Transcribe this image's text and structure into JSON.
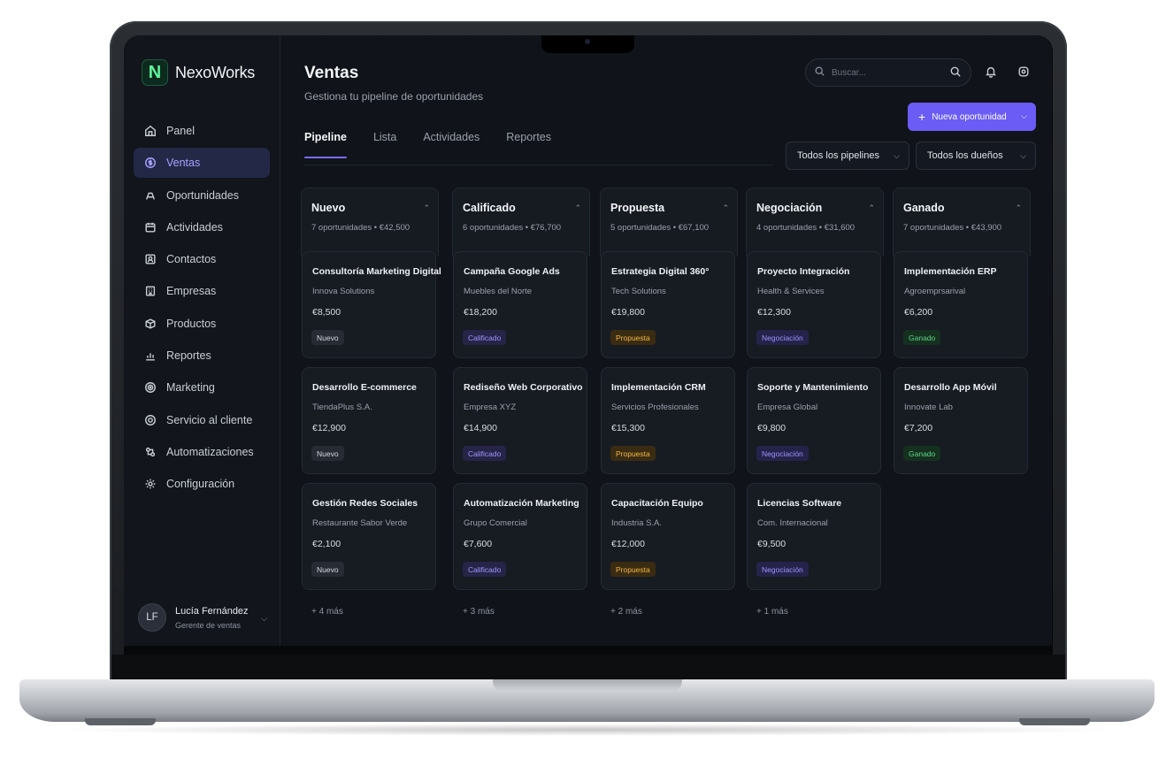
{
  "app": {
    "logo_letter": "N",
    "name": "NexoWorks",
    "brand_color": "#5ff29a",
    "accent_color": "#6a5cf5"
  },
  "sidebar": {
    "items": [
      {
        "label": "Panel",
        "icon": "home-icon",
        "active": false
      },
      {
        "label": "Ventas",
        "icon": "dollar-circle-icon",
        "active": true
      },
      {
        "label": "Oportunidades",
        "icon": "opportunity-icon",
        "active": false
      },
      {
        "label": "Actividades",
        "icon": "calendar-icon",
        "active": false
      },
      {
        "label": "Contactos",
        "icon": "contacts-icon",
        "active": false
      },
      {
        "label": "Empresas",
        "icon": "building-icon",
        "active": false
      },
      {
        "label": "Productos",
        "icon": "box-icon",
        "active": false
      },
      {
        "label": "Reportes",
        "icon": "chart-icon",
        "active": false
      },
      {
        "label": "Marketing",
        "icon": "target-icon",
        "active": false
      },
      {
        "label": "Servicio al cliente",
        "icon": "support-icon",
        "active": false
      },
      {
        "label": "Automatizaciones",
        "icon": "automation-icon",
        "active": false
      },
      {
        "label": "Configuración",
        "icon": "gear-icon",
        "active": false
      }
    ]
  },
  "user": {
    "initials": "LF",
    "name": "Lucía Fernández",
    "role": "Gerente de ventas"
  },
  "header": {
    "title": "Ventas",
    "subtitle": "Gestiona tu pipeline de oportunidades",
    "search_placeholder": "Buscar...",
    "new_button": "Nueva oportunidad"
  },
  "tabs": [
    {
      "label": "Pipeline",
      "active": true
    },
    {
      "label": "Lista",
      "active": false
    },
    {
      "label": "Actividades",
      "active": false
    },
    {
      "label": "Reportes",
      "active": false
    }
  ],
  "filters": {
    "pipelines": "Todos los pipelines",
    "owners": "Todos los dueños"
  },
  "columns": [
    {
      "title": "Nuevo",
      "meta": "7 oportunidades • €42,500",
      "more": "+ 4 más",
      "cards": [
        {
          "title": "Consultoría Marketing Digital",
          "company": "Innova Solutions",
          "value": "€8,500",
          "badge": "Nuevo",
          "badge_class": "b-nuevo"
        },
        {
          "title": "Desarrollo E-commerce",
          "company": "TiendaPlus S.A.",
          "value": "€12,900",
          "badge": "Nuevo",
          "badge_class": "b-nuevo"
        },
        {
          "title": "Gestión Redes Sociales",
          "company": "Restaurante Sabor Verde",
          "value": "€2,100",
          "badge": "Nuevo",
          "badge_class": "b-nuevo"
        }
      ]
    },
    {
      "title": "Calificado",
      "meta": "6 oportunidades • €76,700",
      "more": "+ 3 más",
      "cards": [
        {
          "title": "Campaña Google Ads",
          "company": "Muebles del Norte",
          "value": "€18,200",
          "badge": "Calificado",
          "badge_class": "b-calificado"
        },
        {
          "title": "Rediseño Web Corporativo",
          "company": "Empresa XYZ",
          "value": "€14,900",
          "badge": "Calificado",
          "badge_class": "b-calificado"
        },
        {
          "title": "Automatización Marketing",
          "company": "Grupo Comercial",
          "value": "€7,600",
          "badge": "Calificado",
          "badge_class": "b-calificado"
        }
      ]
    },
    {
      "title": "Propuesta",
      "meta": "5 oportunidades • €67,100",
      "more": "+ 2 más",
      "cards": [
        {
          "title": "Estrategia Digital 360°",
          "company": "Tech Solutions",
          "value": "€19,800",
          "badge": "Propuesta",
          "badge_class": "b-propuesta"
        },
        {
          "title": "Implementación CRM",
          "company": "Servicios Profesionales",
          "value": "€15,300",
          "badge": "Propuesta",
          "badge_class": "b-propuesta"
        },
        {
          "title": "Capacitación Equipo",
          "company": "Industria S.A.",
          "value": "€12,000",
          "badge": "Propuesta",
          "badge_class": "b-propuesta"
        }
      ]
    },
    {
      "title": "Negociación",
      "meta": "4 oportunidades • €31,600",
      "more": "+ 1 más",
      "cards": [
        {
          "title": "Proyecto Integración",
          "company": "Health & Services",
          "value": "€12,300",
          "badge": "Negociación",
          "badge_class": "b-negociacion"
        },
        {
          "title": "Soporte y Mantenimiento",
          "company": "Empresa Global",
          "value": "€9,800",
          "badge": "Negociación",
          "badge_class": "b-negociacion"
        },
        {
          "title": "Licencias Software",
          "company": "Com. Internacional",
          "value": "€9,500",
          "badge": "Negociación",
          "badge_class": "b-negociacion"
        }
      ]
    },
    {
      "title": "Ganado",
      "meta": "7 oportunidades • €43,900",
      "more": "",
      "cards": [
        {
          "title": "Implementación ERP",
          "company": "Agroemprsarival",
          "value": "€6,200",
          "badge": "Ganado",
          "badge_class": "b-ganado"
        },
        {
          "title": "Desarrollo App Móvil",
          "company": "Innovate Lab",
          "value": "€7,200",
          "badge": "Ganado",
          "badge_class": "b-ganado"
        }
      ]
    }
  ]
}
